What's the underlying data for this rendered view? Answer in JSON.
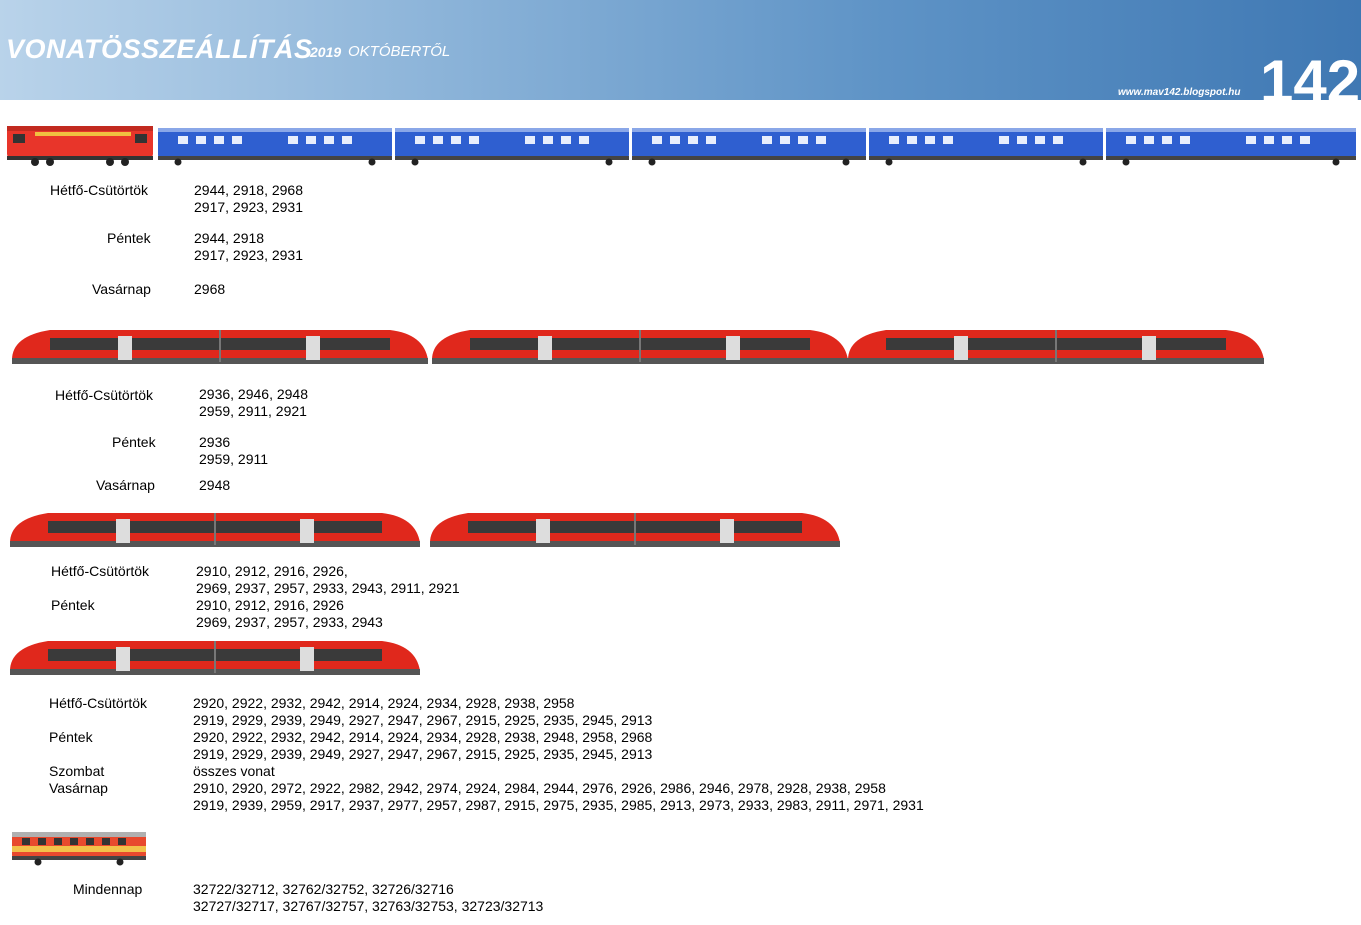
{
  "header": {
    "title": "VONATÖSSZEÁLLÍTÁS",
    "year": "2019",
    "subtitle": "OKTÓBERTŐL",
    "url": "www.mav142.blogspot.hu",
    "number": "142"
  },
  "colors": {
    "locomotive": "#e8352a",
    "coach": "#2f5fd0",
    "desiro": "#e0281c",
    "railbus": "#e8492e"
  },
  "sections": [
    {
      "train": "locomotive-with-5-coaches",
      "rows": [
        {
          "label": "Hétfő-Csütörtök",
          "lines": [
            "2944, 2918, 2968",
            "2917, 2923, 2931"
          ]
        },
        {
          "label": "Péntek",
          "lines": [
            "2944, 2918",
            "2917, 2923, 2931"
          ]
        },
        {
          "label": "Vasárnap",
          "lines": [
            "2968"
          ]
        }
      ]
    },
    {
      "train": "three-desiro-units",
      "rows": [
        {
          "label": "Hétfő-Csütörtök",
          "lines": [
            "2936, 2946, 2948",
            "2959, 2911, 2921"
          ]
        },
        {
          "label": "Péntek",
          "lines": [
            "2936",
            "2959, 2911"
          ]
        },
        {
          "label": "Vasárnap",
          "lines": [
            "2948"
          ]
        }
      ]
    },
    {
      "train": "two-desiro-units",
      "rows": [
        {
          "label": "Hétfő-Csütörtök",
          "lines": [
            "2910, 2912, 2916, 2926,",
            "2969, 2937, 2957, 2933, 2943, 2911, 2921"
          ]
        },
        {
          "label": "Péntek",
          "lines": [
            "2910, 2912, 2916, 2926",
            "2969, 2937, 2957, 2933, 2943"
          ]
        }
      ]
    },
    {
      "train": "one-desiro-unit",
      "rows": [
        {
          "label": "Hétfő-Csütörtök",
          "lines": [
            "2920, 2922, 2932, 2942, 2914, 2924, 2934, 2928, 2938, 2958",
            "2919, 2929, 2939, 2949, 2927, 2947, 2967, 2915, 2925, 2935, 2945, 2913"
          ]
        },
        {
          "label": "Péntek",
          "lines": [
            "2920, 2922, 2932, 2942, 2914, 2924, 2934, 2928, 2938, 2948, 2958, 2968",
            "2919, 2929, 2939, 2949, 2927, 2947, 2967, 2915, 2925, 2935, 2945, 2913"
          ]
        },
        {
          "label": "Szombat",
          "lines": [
            "összes vonat"
          ]
        },
        {
          "label": "Vasárnap",
          "lines": [
            "2910, 2920, 2972, 2922, 2982, 2942, 2974, 2924, 2984, 2944, 2976, 2926, 2986, 2946, 2978, 2928, 2938, 2958",
            "2919, 2939, 2959, 2917, 2937, 2977, 2957, 2987, 2915, 2975, 2935, 2985, 2913, 2973, 2933, 2983, 2911, 2971, 2931"
          ]
        }
      ]
    },
    {
      "train": "railbus",
      "rows": [
        {
          "label": "Mindennap",
          "lines": [
            "32722/32712, 32762/32752, 32726/32716",
            "32727/32717, 32767/32757, 32763/32753, 32723/32713"
          ]
        }
      ]
    }
  ]
}
